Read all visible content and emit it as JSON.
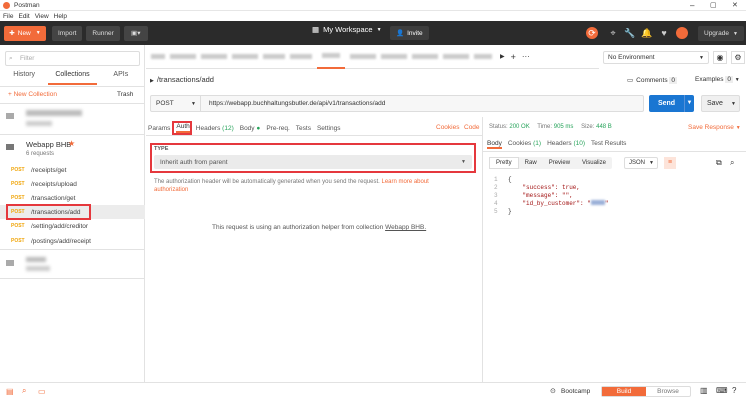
{
  "app": {
    "title": "Postman"
  },
  "menu": [
    "File",
    "Edit",
    "View",
    "Help"
  ],
  "toolbar": {
    "new": "New",
    "import": "Import",
    "runner": "Runner",
    "workspace": "My Workspace",
    "invite": "Invite",
    "upgrade": "Upgrade"
  },
  "sidebar": {
    "search_placeholder": "Filter",
    "tabs": [
      "History",
      "Collections",
      "APIs"
    ],
    "new_collection": "+ New Collection",
    "trash": "Trash",
    "collection_name": "Webapp BHB",
    "collection_count": "6 requests",
    "requests": [
      {
        "method": "POST",
        "name": "/receipts/get"
      },
      {
        "method": "POST",
        "name": "/receipts/upload"
      },
      {
        "method": "POST",
        "name": "/transaction/get"
      },
      {
        "method": "POST",
        "name": "/transactions/add"
      },
      {
        "method": "POST",
        "name": "/setting/add/creditor"
      },
      {
        "method": "POST",
        "name": "/postings/add/receipt"
      }
    ]
  },
  "env": {
    "selected": "No Environment"
  },
  "request": {
    "breadcrumb": "/transactions/add",
    "comments": "Comments",
    "comments_count": "0",
    "examples": "Examples",
    "examples_count": "0",
    "method": "POST",
    "url": "https://webapp.buchhaltungsbutler.de/api/v1/transactions/add",
    "send": "Send",
    "save": "Save",
    "tabs": [
      "Params",
      "Auth",
      "Headers",
      "(12)",
      "Body",
      "Pre-req.",
      "Tests",
      "Settings"
    ],
    "cookies": "Cookies",
    "code": "Code",
    "auth_type_label": "TYPE",
    "auth_type_value": "Inherit auth from parent",
    "auth_desc": "The authorization header will be automatically generated when you send the request.",
    "auth_link": "Learn more about authorization",
    "auth_helper": "This request is using an authorization helper from collection",
    "auth_helper_link": "Webapp BHB."
  },
  "response": {
    "status_label": "Status:",
    "status": "200 OK",
    "time_label": "Time:",
    "time": "905 ms",
    "size_label": "Size:",
    "size": "448 B",
    "save_response": "Save Response",
    "tabs": [
      "Body",
      "Cookies",
      "(1)",
      "Headers",
      "(10)",
      "Test Results"
    ],
    "views": [
      "Pretty",
      "Raw",
      "Preview",
      "Visualize"
    ],
    "format": "JSON",
    "lines": [
      "{",
      "    \"success\": true,",
      "    \"message\": \"\",",
      "    \"id_by_customer\": \"",
      "}"
    ],
    "line_numbers": [
      "1",
      "2",
      "3",
      "4",
      "5"
    ]
  },
  "statusbar": {
    "bootcamp": "Bootcamp",
    "build": "Build",
    "browse": "Browse"
  },
  "colors": {
    "accent": "#f26b3a",
    "send": "#1a76d2",
    "highlight": "#e5383d"
  }
}
